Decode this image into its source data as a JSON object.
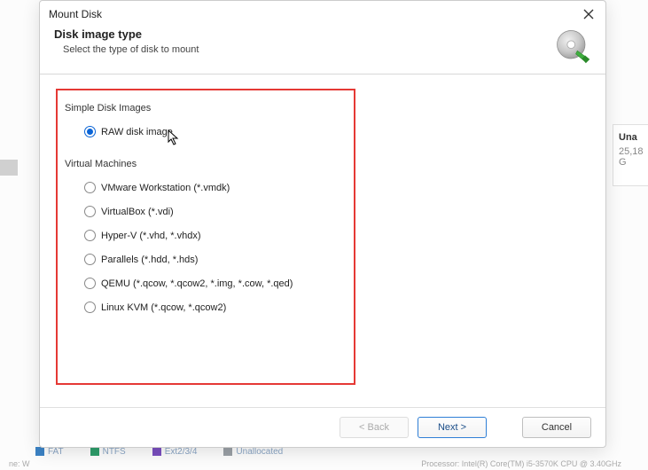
{
  "dialog": {
    "title": "Mount Disk",
    "header": {
      "title": "Disk image type",
      "subtitle": "Select the type of disk to mount"
    },
    "groups": {
      "simple": {
        "label": "Simple Disk Images",
        "options": {
          "raw": "RAW disk image"
        }
      },
      "vm": {
        "label": "Virtual Machines",
        "options": {
          "vmware": "VMware Workstation (*.vmdk)",
          "vbox": "VirtualBox (*.vdi)",
          "hyperv": "Hyper-V (*.vhd, *.vhdx)",
          "parallels": "Parallels (*.hdd, *.hds)",
          "qemu": "QEMU (*.qcow, *.qcow2, *.img, *.cow, *.qed)",
          "kvm": "Linux KVM (*.qcow, *.qcow2)"
        }
      }
    },
    "buttons": {
      "back": "< Back",
      "next": "Next >",
      "cancel": "Cancel"
    }
  },
  "background": {
    "right_panel": {
      "line1": "Una",
      "line2": "25,18 G"
    },
    "bottom_items": {
      "fat": "FAT",
      "ntfs": "NTFS",
      "ext": "Ext2/3/4",
      "unalloc": "Unallocated"
    },
    "bottom_left": "ne: W",
    "bottom_right": "Processor: Intel(R) Core(TM) i5-3570K CPU @ 3.40GHz"
  }
}
